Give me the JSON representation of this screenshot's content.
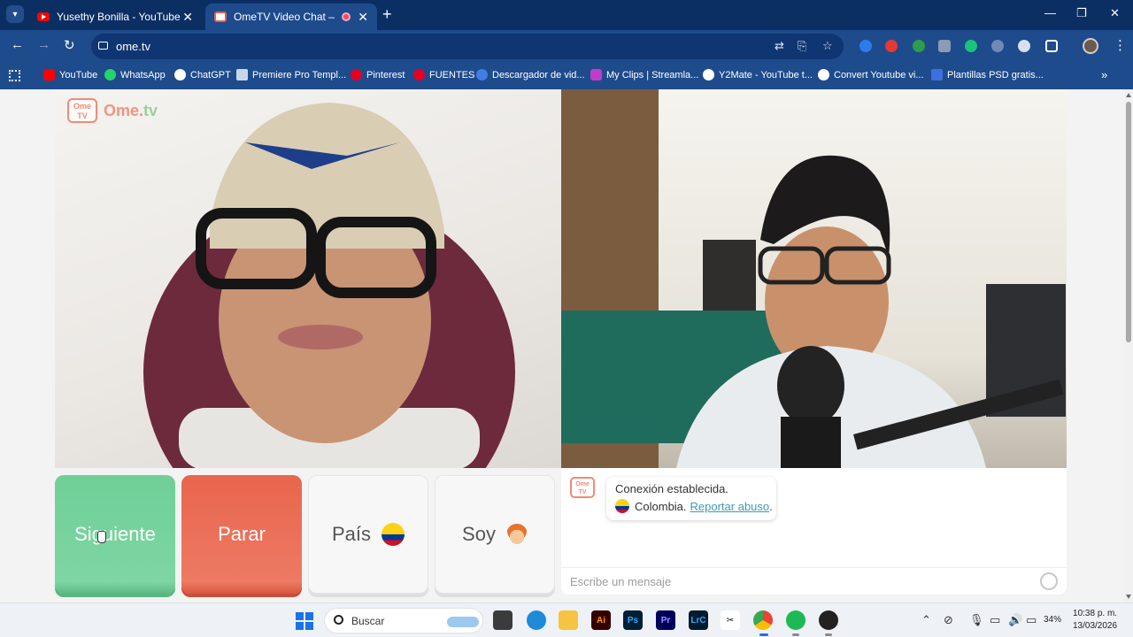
{
  "browser": {
    "tabs": [
      {
        "title": "Yusethy Bonilla - YouTube",
        "active": false
      },
      {
        "title": "OmeTV Video Chat — Ome",
        "active": true
      }
    ],
    "url": "ome.tv",
    "bookmarks": [
      "YouTube",
      "WhatsApp",
      "ChatGPT",
      "Premiere Pro Templ...",
      "Pinterest",
      "FUENTES",
      "Descargador de vid...",
      "My Clips | Streamla...",
      "Y2Mate - YouTube t...",
      "Convert Youtube vi...",
      "Plantillas PSD gratis..."
    ]
  },
  "app": {
    "logo": {
      "tv_badge": "Ome\nTV",
      "name_main": "Ome.",
      "name_tv": "tv"
    },
    "buttons": {
      "next": "Siguiente",
      "stop": "Parar",
      "country": "País",
      "gender": "Soy"
    },
    "chat": {
      "status": "Conexión establecida.",
      "country": "Colombia.",
      "report": "Reportar abuso",
      "report_suffix": ".",
      "input_placeholder": "Escribe un mensaje"
    }
  },
  "taskbar": {
    "search_placeholder": "Buscar",
    "battery": "34%",
    "time": "10:38 p. m.",
    "date": "13/03/2026"
  }
}
